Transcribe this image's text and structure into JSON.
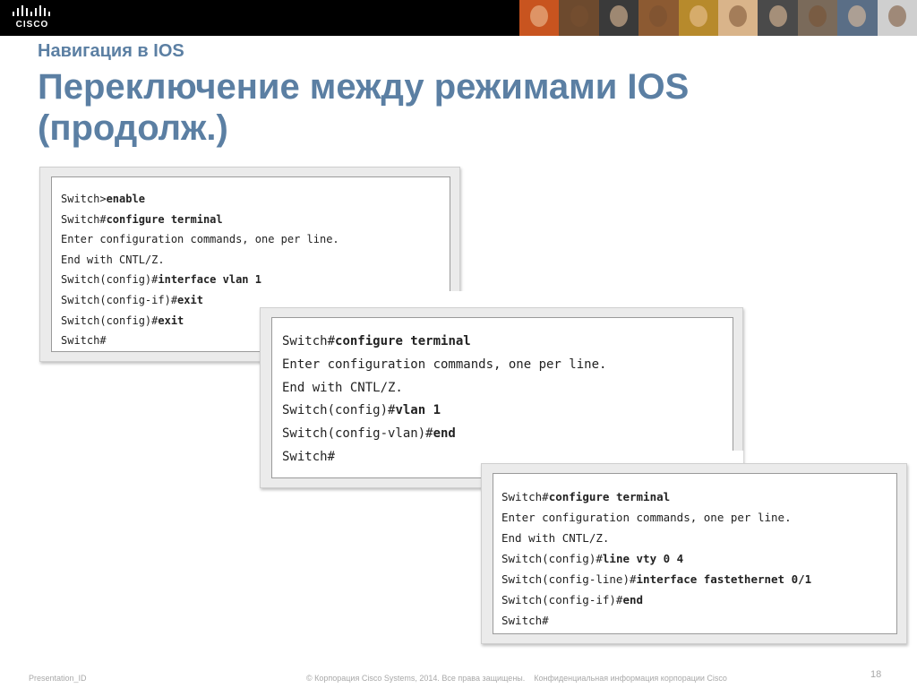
{
  "header": {
    "logo_text": "CISCO",
    "photo_colors": [
      "#c8541f",
      "#6d4a2e",
      "#3a3a3a",
      "#8c5a32",
      "#b78a2c",
      "#d9b48a",
      "#4a4a4a",
      "#7a6a5a",
      "#5a6e86",
      "#cfcfcf"
    ]
  },
  "slide": {
    "subtitle": "Навигация в IOS",
    "title": "Переключение между режимами IOS (продолж.)"
  },
  "terminals": [
    {
      "lines": [
        {
          "prompt": "Switch>",
          "cmd": "enable"
        },
        {
          "prompt": "Switch#",
          "cmd": "configure terminal"
        },
        {
          "prompt": "Enter configuration commands, one per line.",
          "cmd": ""
        },
        {
          "prompt": "End with CNTL/Z.",
          "cmd": ""
        },
        {
          "prompt": "Switch(config)#",
          "cmd": "interface vlan 1"
        },
        {
          "prompt": "Switch(config-if)#",
          "cmd": "exit"
        },
        {
          "prompt": "Switch(config)#",
          "cmd": "exit"
        },
        {
          "prompt": "Switch#",
          "cmd": ""
        }
      ]
    },
    {
      "lines": [
        {
          "prompt": "Switch#",
          "cmd": "configure terminal"
        },
        {
          "prompt": "Enter configuration commands, one per line.",
          "cmd": ""
        },
        {
          "prompt": "End with CNTL/Z.",
          "cmd": ""
        },
        {
          "prompt": "Switch(config)#",
          "cmd": "vlan 1"
        },
        {
          "prompt": "Switch(config-vlan)#",
          "cmd": "end"
        },
        {
          "prompt": "Switch#",
          "cmd": ""
        }
      ]
    },
    {
      "lines": [
        {
          "prompt": "Switch#",
          "cmd": "configure terminal"
        },
        {
          "prompt": "Enter configuration commands, one per line.",
          "cmd": ""
        },
        {
          "prompt": "End with CNTL/Z.",
          "cmd": ""
        },
        {
          "prompt": "Switch(config)#",
          "cmd": "line vty 0 4"
        },
        {
          "prompt": "Switch(config-line)#",
          "cmd": "interface fastethernet 0/1"
        },
        {
          "prompt": "Switch(config-if)#",
          "cmd": "end"
        },
        {
          "prompt": "Switch#",
          "cmd": ""
        }
      ]
    }
  ],
  "footer": {
    "presentation_id": "Presentation_ID",
    "copyright": "© Корпорация Cisco Systems, 2014. Все права защищены.    Конфиденциальная информация корпорации Cisco",
    "page_number": "18"
  }
}
